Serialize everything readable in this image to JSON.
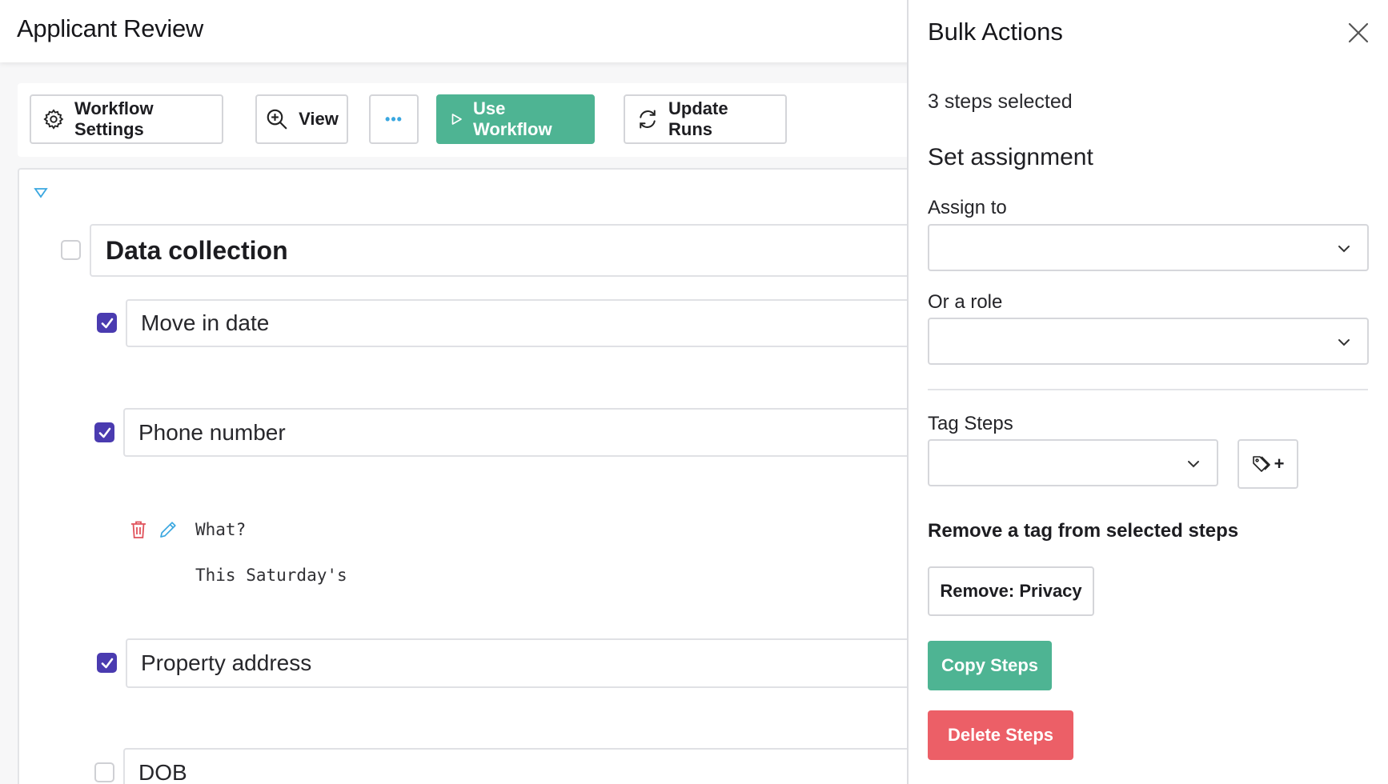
{
  "header": {
    "title": "Applicant Review"
  },
  "toolbar": {
    "workflow_settings": "Workflow Settings",
    "view": "View",
    "more": "•••",
    "use_workflow": "Use Workflow",
    "update_runs": "Update Runs"
  },
  "workflow": {
    "section": {
      "title": "Data collection",
      "checked": false
    },
    "steps": [
      {
        "label": "Move in date",
        "checked": true
      },
      {
        "label": "Phone number",
        "checked": true
      },
      {
        "label": "Property address",
        "checked": true
      },
      {
        "label": "DOB",
        "checked": false
      }
    ],
    "note": {
      "title": "What?",
      "body": "This Saturday's"
    }
  },
  "panel": {
    "title": "Bulk Actions",
    "selected_count": "3 steps selected",
    "set_assignment": "Set assignment",
    "assign_to_label": "Assign to",
    "role_label": "Or a role",
    "tag_steps_label": "Tag Steps",
    "tag_add_label": "+",
    "remove_tag_heading": "Remove a tag from selected steps",
    "remove_privacy": "Remove: Privacy",
    "copy_steps": "Copy Steps",
    "delete_steps": "Delete Steps"
  },
  "colors": {
    "accent_green": "#4eb493",
    "danger_red": "#ec5f67",
    "checkbox_purple": "#4a3bb0",
    "icon_blue": "#3aa7e0"
  }
}
